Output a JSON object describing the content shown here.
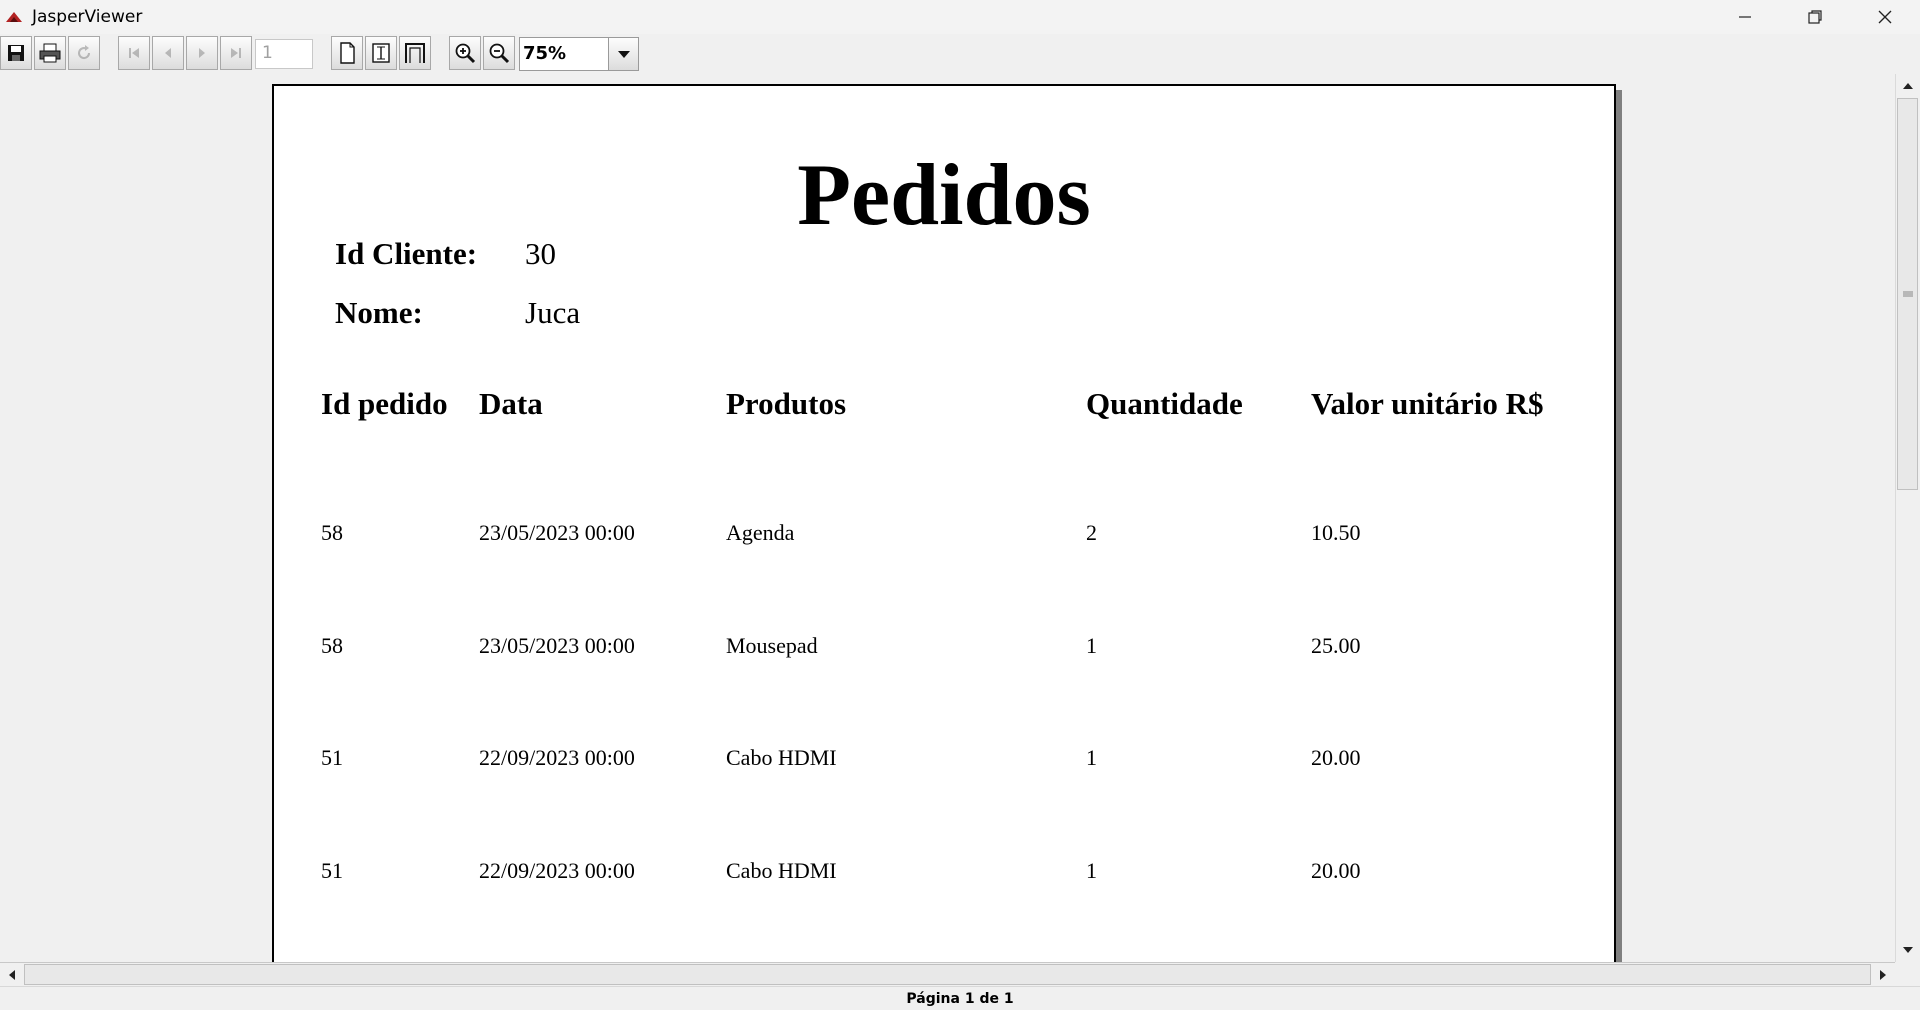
{
  "window": {
    "title": "JasperViewer"
  },
  "toolbar": {
    "page_number": "1",
    "zoom": "75%",
    "icons": [
      "save-icon",
      "print-icon",
      "reload-icon",
      "first-page-icon",
      "previous-page-icon",
      "next-page-icon",
      "last-page-icon",
      "actual-size-icon",
      "fit-page-icon",
      "fit-width-icon",
      "zoom-in-icon",
      "zoom-out-icon",
      "dropdown-arrow-icon"
    ]
  },
  "report": {
    "title": "Pedidos",
    "client_id_label": "Id Cliente:",
    "client_id_value": "30",
    "name_label": "Nome:",
    "name_value": "Juca",
    "columns": [
      "Id pedido",
      "Data",
      "Produtos",
      "Quantidade",
      "Valor unitário R$"
    ],
    "rows": [
      [
        "58",
        "23/05/2023 00:00",
        "Agenda",
        "2",
        "10.50"
      ],
      [
        "58",
        "23/05/2023 00:00",
        "Mousepad",
        "1",
        "25.00"
      ],
      [
        "51",
        "22/09/2023 00:00",
        "Cabo HDMI",
        "1",
        "20.00"
      ],
      [
        "51",
        "22/09/2023 00:00",
        "Cabo HDMI",
        "1",
        "20.00"
      ]
    ]
  },
  "status": {
    "text": "Página 1 de 1"
  },
  "colors": {
    "background": "#f0f0f0",
    "page": "#ffffff",
    "shadow": "#808080"
  }
}
